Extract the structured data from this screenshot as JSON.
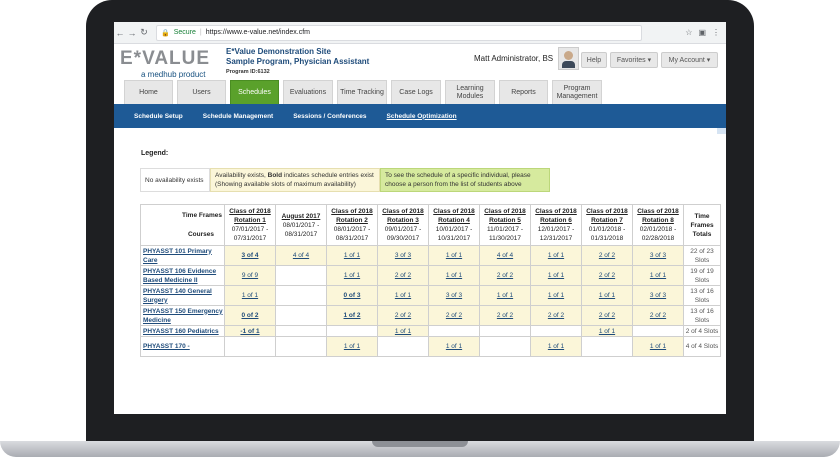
{
  "browser": {
    "secure_label": "Secure",
    "url": "https://www.e-value.net/index.cfm"
  },
  "header": {
    "logo": "E*VALUE",
    "logo_sub": "a medhub product",
    "site_line1": "E*Value Demonstration Site",
    "site_line2": "Sample Program, Physician Assistant",
    "program_id": "Program ID:6132",
    "user_name": "Matt Administrator, BS",
    "help_label": "Help",
    "favorites_label": "Favorites ▾",
    "account_label": "My Account ▾"
  },
  "tabs": [
    {
      "label": "Home"
    },
    {
      "label": "Users"
    },
    {
      "label": "Schedules"
    },
    {
      "label": "Evaluations"
    },
    {
      "label": "Time Tracking"
    },
    {
      "label": "Case Logs"
    },
    {
      "label": "Learning Modules"
    },
    {
      "label": "Reports"
    },
    {
      "label": "Program Management"
    }
  ],
  "subnav": [
    {
      "label": "Schedule Setup"
    },
    {
      "label": "Schedule Management"
    },
    {
      "label": "Sessions / Conferences"
    },
    {
      "label": "Schedule Optimization"
    }
  ],
  "legend": {
    "title": "Legend:",
    "item1": "No availability exists",
    "item2": "Availability exists, Bold indicates schedule entries exist (Showing available slots of maximum availability)",
    "item2_bold": "Bold",
    "item3": "To see the schedule of a specific individual, please choose a person from the list of students above",
    "colors": {
      "item2": "#fbf6d9",
      "item3": "#d6ea9e"
    }
  },
  "table": {
    "corner_timeframes": "Time Frames",
    "corner_courses": "Courses",
    "totals_header": "Time Frames Totals",
    "columns": [
      {
        "cls": "Class of 2018",
        "rot": "Rotation 1",
        "dates": "07/01/2017 - 07/31/2017"
      },
      {
        "cls": "",
        "rot": "August 2017",
        "dates": "08/01/2017 - 08/31/2017"
      },
      {
        "cls": "Class of 2018",
        "rot": "Rotation 2",
        "dates": "08/01/2017 - 08/31/2017"
      },
      {
        "cls": "Class of 2018",
        "rot": "Rotation 3",
        "dates": "09/01/2017 - 09/30/2017"
      },
      {
        "cls": "Class of 2018",
        "rot": "Rotation 4",
        "dates": "10/01/2017 - 10/31/2017"
      },
      {
        "cls": "Class of 2018",
        "rot": "Rotation 5",
        "dates": "11/01/2017 - 11/30/2017"
      },
      {
        "cls": "Class of 2018",
        "rot": "Rotation 6",
        "dates": "12/01/2017 - 12/31/2017"
      },
      {
        "cls": "Class of 2018",
        "rot": "Rotation 7",
        "dates": "01/01/2018 - 01/31/2018"
      },
      {
        "cls": "Class of 2018",
        "rot": "Rotation 8",
        "dates": "02/01/2018 - 02/28/2018"
      }
    ],
    "rows": [
      {
        "course": "PHYASST 101 Primary Care",
        "cells": [
          "3 of 4",
          "4 of 4",
          "1 of 1",
          "3 of 3",
          "1 of 1",
          "4 of 4",
          "1 of 1",
          "2 of 2",
          "3 of 3"
        ],
        "bold": [
          0
        ],
        "total": "22 of 23 Slots"
      },
      {
        "course": "PHYASST 106 Evidence Based Medicine II",
        "cells": [
          "9 of 9",
          "",
          "1 of 1",
          "2 of 2",
          "1 of 1",
          "2 of 2",
          "1 of 1",
          "2 of 2",
          "1 of 1"
        ],
        "bold": [],
        "total": "19 of 19 Slots"
      },
      {
        "course": "PHYASST 140 General Surgery",
        "cells": [
          "1 of 1",
          "",
          "0 of 3",
          "1 of 1",
          "3 of 3",
          "1 of 1",
          "1 of 1",
          "1 of 1",
          "3 of 3"
        ],
        "bold": [
          2
        ],
        "total": "13 of 16 Slots"
      },
      {
        "course": "PHYASST 150 Emergency Medicine",
        "cells": [
          "0 of 2",
          "",
          "1 of 2",
          "2 of 2",
          "2 of 2",
          "2 of 2",
          "2 of 2",
          "2 of 2",
          "2 of 2"
        ],
        "bold": [
          0,
          2
        ],
        "total": "13 of 16 Slots"
      },
      {
        "course": "PHYASST 160 Pediatrics",
        "cells": [
          "-1 of 1",
          "",
          "",
          "1 of 1",
          "",
          "",
          "",
          "1 of 1",
          ""
        ],
        "bold": [
          0
        ],
        "total": "2 of 4 Slots"
      },
      {
        "course": "PHYASST 170 -",
        "cells": [
          "",
          "",
          "1 of 1",
          "",
          "1 of 1",
          "",
          "1 of 1",
          "",
          "1 of 1"
        ],
        "bold": [],
        "total": "4 of 4 Slots"
      }
    ]
  }
}
